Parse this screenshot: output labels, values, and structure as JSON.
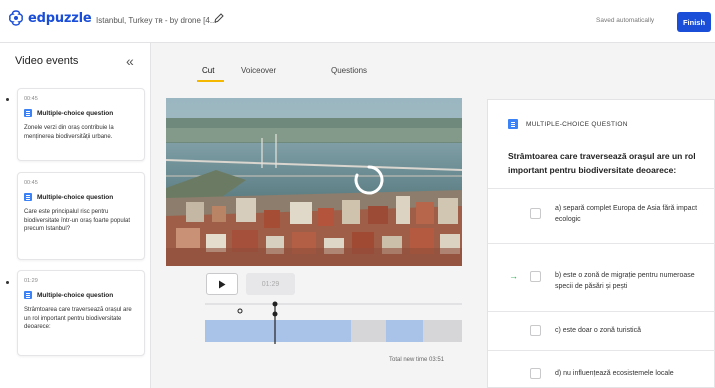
{
  "app": {
    "logo_text": "edpuzzle",
    "project_title": "Istanbul, Turkey ᴛʀ - by drone [4...",
    "saved_status": "Saved automatically",
    "finish_label": "Finish"
  },
  "sidebar": {
    "title": "Video events",
    "events": [
      {
        "time": "00:45",
        "type": "Multiple-choice question",
        "text": "Zonele verzi din oraș contribuie la menținerea biodiversității urbane."
      },
      {
        "time": "00:45",
        "type": "Multiple-choice question",
        "text": "Care este principalul risc pentru biodiversitate într-un oraș foarte populat precum Istanbul?"
      },
      {
        "time": "01:29",
        "type": "Multiple-choice question",
        "text": "Strâmtoarea care traversează orașul are un rol important pentru biodiversitate deoarece:"
      }
    ]
  },
  "tabs": [
    {
      "label": "Cut",
      "active": true
    },
    {
      "label": "Voiceover",
      "active": false
    },
    {
      "label": "Questions",
      "active": false
    }
  ],
  "player": {
    "current_time": "01:29",
    "total_time": "Total new time 03:51"
  },
  "question": {
    "type_label": "MULTIPLE-CHOICE QUESTION",
    "text": "Strâmtoarea care traversează orașul are un rol important pentru biodiversitate deoarece:",
    "answers": [
      {
        "text": "a) separă complet Europa de Asia fără impact ecologic",
        "correct": false
      },
      {
        "text": "b) este o zonă de migrație pentru numeroase specii de păsări și pești",
        "correct": true
      },
      {
        "text": "c) este doar o zonă turistică",
        "correct": false
      },
      {
        "text": "d) nu influențează ecosistemele locale",
        "correct": false
      }
    ]
  },
  "colors": {
    "brand": "#1a4ed8",
    "accent_tab": "#f5b800",
    "correct": "#1eaa4a",
    "segment_kept": "#a9c2e8",
    "segment_cut": "#d6d6d9"
  }
}
